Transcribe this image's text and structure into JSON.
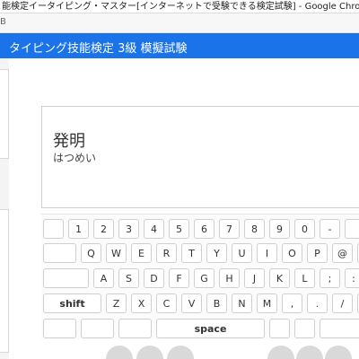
{
  "window": {
    "title": "能検定イータイピング・マスター[インターネットで受験できる検定試験] - Google Chrome"
  },
  "address": {
    "fragment": "B"
  },
  "app": {
    "title": "タイピング技能検定 3級 模擬試験"
  },
  "question": {
    "word": "発明",
    "reading": "はつめい"
  },
  "keyboard": {
    "rows": [
      [
        "",
        "1",
        "2",
        "3",
        "4",
        "5",
        "6",
        "7",
        "8",
        "9",
        "0",
        "-",
        ""
      ],
      [
        "",
        "Q",
        "W",
        "E",
        "R",
        "T",
        "Y",
        "U",
        "I",
        "O",
        "P",
        "@",
        ""
      ],
      [
        "",
        "A",
        "S",
        "D",
        "F",
        "G",
        "H",
        "J",
        "K",
        "L",
        ";",
        ":"
      ],
      [
        "shift",
        "Z",
        "X",
        "C",
        "V",
        "B",
        "N",
        "M",
        ",",
        ".",
        "/",
        ""
      ],
      [
        "",
        "",
        "",
        "space",
        "",
        "",
        ""
      ]
    ]
  }
}
